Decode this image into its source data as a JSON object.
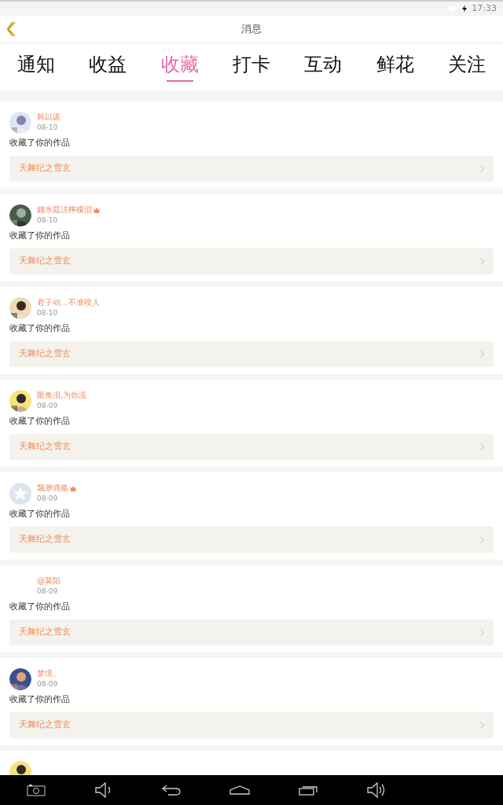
{
  "status_bar": {
    "time": "17:33"
  },
  "header": {
    "title": "消息"
  },
  "tabs": [
    {
      "label": "通知",
      "selected": false
    },
    {
      "label": "收益",
      "selected": false
    },
    {
      "label": "收藏",
      "selected": true
    },
    {
      "label": "打卡",
      "selected": false
    },
    {
      "label": "互动",
      "selected": false
    },
    {
      "label": "鲜花",
      "selected": false
    },
    {
      "label": "关注",
      "selected": false
    }
  ],
  "items": [
    {
      "user": "韩以诺",
      "vip": false,
      "date": "08-10",
      "action": "收藏了你的作品",
      "work": "天舞纪之雪玄"
    },
    {
      "user": "錢水菇涼檸檬泪",
      "vip": true,
      "date": "08-10",
      "action": "收藏了你的作品",
      "work": "天舞纪之雪玄"
    },
    {
      "user": "君子动...不准咬人",
      "vip": false,
      "date": "08-10",
      "action": "收藏了你的作品",
      "work": "天舞纪之雪玄"
    },
    {
      "user": "眼角泪,为你流",
      "vip": false,
      "date": "08-09",
      "action": "收藏了你的作品",
      "work": "天舞纪之雪玄"
    },
    {
      "user": "飄渺滴殇",
      "vip": true,
      "avatar": {
        "kind": "default"
      },
      "date": "08-09",
      "action": "收藏了你的作品",
      "work": "天舞纪之雪玄"
    },
    {
      "user": "@莫陌",
      "vip": false,
      "date": "08-09",
      "action": "收藏了你的作品",
      "work": "天舞纪之雪玄"
    },
    {
      "user": "梦境。",
      "vip": false,
      "date": "08-09",
      "action": "收藏了你的作品",
      "work": "天舞纪之雪玄"
    }
  ]
}
